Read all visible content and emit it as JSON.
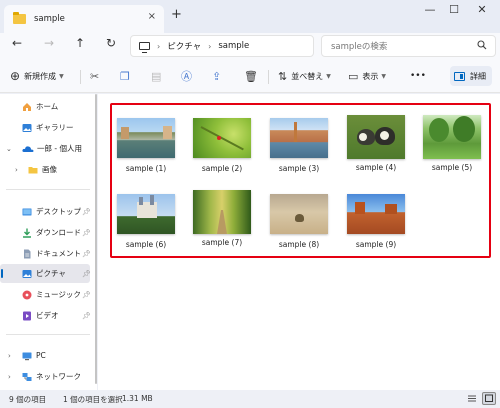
{
  "tab": {
    "title": "sample",
    "close": "×",
    "new_tab": "+"
  },
  "window": {
    "minimize": "—",
    "maximize": "☐",
    "close": "✕"
  },
  "nav": {
    "back": "←",
    "forward": "→",
    "up": "↑",
    "refresh": "↻"
  },
  "address": {
    "root": "ピクチャ",
    "separator": "›",
    "folder": "sample",
    "separator2": "›"
  },
  "search": {
    "placeholder": "sampleの検索",
    "icon": "search-icon"
  },
  "commands": {
    "new_label": "新規作成",
    "sort_label": "並べ替え",
    "view_label": "表示",
    "more_label": "•••",
    "details_label": "詳細"
  },
  "sidebar": {
    "items": [
      {
        "label": "ホーム",
        "icon": "home-icon"
      },
      {
        "label": "ギャラリー",
        "icon": "gallery-icon"
      },
      {
        "label": "一郎 - 個人用",
        "icon": "onedrive-cloud-icon"
      },
      {
        "label": "画像",
        "icon": "folder-icon"
      },
      {
        "label": "デスクトップ",
        "icon": "desktop-icon"
      },
      {
        "label": "ダウンロード",
        "icon": "download-icon"
      },
      {
        "label": "ドキュメント",
        "icon": "documents-icon"
      },
      {
        "label": "ピクチャ",
        "icon": "pictures-icon"
      },
      {
        "label": "ミュージック",
        "icon": "music-icon"
      },
      {
        "label": "ビデオ",
        "icon": "video-icon"
      },
      {
        "label": "PC",
        "icon": "pc-icon"
      },
      {
        "label": "ネットワーク",
        "icon": "network-icon"
      }
    ]
  },
  "files": [
    {
      "name": "sample (1)",
      "scene": "canal-town"
    },
    {
      "name": "sample (2)",
      "scene": "ladybug-leaf"
    },
    {
      "name": "sample (3)",
      "scene": "venice-canal"
    },
    {
      "name": "sample (4)",
      "scene": "ducklings"
    },
    {
      "name": "sample (5)",
      "scene": "park-trees"
    },
    {
      "name": "sample (6)",
      "scene": "castle"
    },
    {
      "name": "sample (7)",
      "scene": "forest-path"
    },
    {
      "name": "sample (8)",
      "scene": "desert-rock"
    },
    {
      "name": "sample (9)",
      "scene": "monument-valley"
    }
  ],
  "status": {
    "item_count": "9 個の項目",
    "selection": "1 個の項目を選択",
    "size": "1.31 MB"
  },
  "colors": {
    "accent": "#0067c0",
    "highlight_border": "#e50012",
    "folder": "#f4c542"
  }
}
